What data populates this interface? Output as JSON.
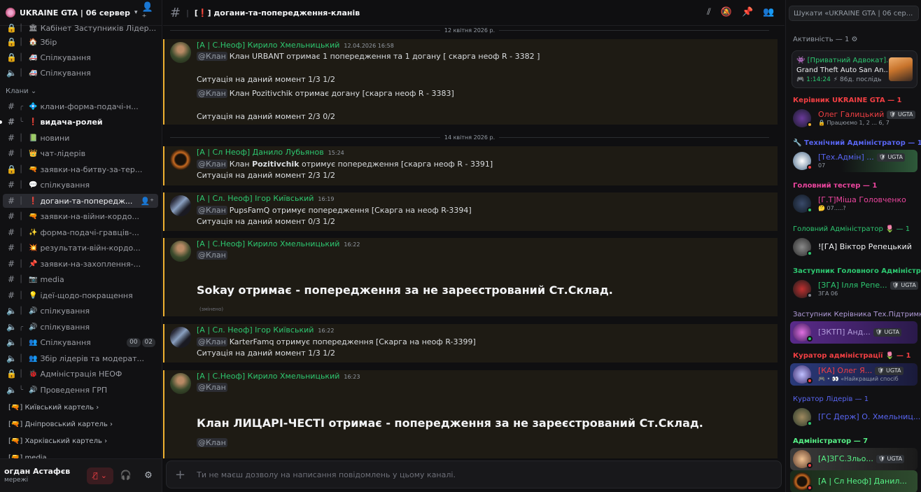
{
  "server": {
    "name": "UKRAINE GTA | 06 сервер"
  },
  "sidebar": {
    "channels": [
      {
        "icon": "lock",
        "emoji": "🏛",
        "name": "Кабінет Заступників Лідер..."
      },
      {
        "icon": "lock",
        "emoji": "🏠",
        "name": "Збір"
      },
      {
        "icon": "lock",
        "emoji": "🚑",
        "name": "Спілкування"
      },
      {
        "icon": "speaker",
        "emoji": "🚑",
        "name": "Спілкування"
      },
      {
        "icon": "hash",
        "emoji": "💠",
        "name": "клани-форма-подачі-н..."
      },
      {
        "icon": "hash",
        "emoji": "❗",
        "name": "видача-ролей"
      },
      {
        "icon": "hash",
        "emoji": "📗",
        "name": "новини"
      },
      {
        "icon": "hash",
        "emoji": "👑",
        "name": "чат-лідерів"
      },
      {
        "icon": "lock",
        "emoji": "🔫",
        "name": "заявки-на-битву-за-тер..."
      },
      {
        "icon": "hash",
        "emoji": "💬",
        "name": "спілкування"
      },
      {
        "icon": "hash",
        "emoji": "❗",
        "name": "догани-та-попередж..."
      },
      {
        "icon": "hash",
        "emoji": "🔫",
        "name": "заявки-на-війни-кордо..."
      },
      {
        "icon": "hash",
        "emoji": "✨",
        "name": "форма-подачі-гравців-..."
      },
      {
        "icon": "hash",
        "emoji": "💥",
        "name": "результати-війн-кордо..."
      },
      {
        "icon": "hash",
        "emoji": "📌",
        "name": "заявки-на-захоплення-..."
      },
      {
        "icon": "hash",
        "emoji": "📷",
        "name": "media"
      },
      {
        "icon": "hash",
        "emoji": "💡",
        "name": "ідеї-щодо-покращення"
      },
      {
        "icon": "speaker",
        "emoji": "🔊",
        "name": "спілкування"
      },
      {
        "icon": "speaker",
        "emoji": "🔊",
        "name": "спілкування"
      },
      {
        "icon": "speaker",
        "emoji": "👥",
        "name": "Спілкування"
      },
      {
        "icon": "speaker",
        "emoji": "👥",
        "name": "Збір лідерів та модерат..."
      },
      {
        "icon": "lock",
        "emoji": "🐞",
        "name": "Адміністрація НЕОФ"
      },
      {
        "icon": "speaker",
        "emoji": "🔊",
        "name": "Проведення ГРП"
      }
    ],
    "category": "Клани",
    "voice_badges": [
      "00",
      "02"
    ],
    "folders": [
      "Київський картель",
      "Дніпровський картель",
      "Харківський картель",
      "media"
    ]
  },
  "user": {
    "name": "огдан Астафєв",
    "status": "мережі"
  },
  "channel": {
    "title": "догани-та-попередження-кланів"
  },
  "messages": {
    "date1": "12 квітня 2026 р.",
    "date2": "14 квітня 2026 р.",
    "m1": {
      "author": "[А | С.Неоф] Кирило Хмельницький",
      "time": "12.04.2026 16:58",
      "mention": "@Клан",
      "l1": "Клан URBANT отримає 1 попередження та 1 догану [ скарга неоф R - 3382 ]",
      "l2": "Ситуація на даний момент 1/3 1/2",
      "l3": "Клан Pozitivchik отримає догану [скарга неоф R - 3383]",
      "l4": "Ситуація на даний момент 2/3 0/2"
    },
    "m2": {
      "author": "[А | Сл Неоф] Данило Лубьянов",
      "time": "15:24",
      "mention": "@Клан",
      "l1a": "Клан ",
      "l1b": "Pozitivchik",
      "l1c": " отримує попередження [скарга неоф R - 3391]",
      "l2": "Ситуація на даний момент 2/3 1/2"
    },
    "m3": {
      "author": "[А | Сл. Неоф] Ігор Київський",
      "time": "16:19",
      "mention": "@Клан",
      "l1": "PupsFamQ отримує попередження [Скарга на неоф R-3394]",
      "l2": "Ситуація на даний момент 0/3 1/2"
    },
    "m4": {
      "author": "[А | С.Неоф] Кирило Хмельницький",
      "time": "16:22",
      "mention": "@Клан",
      "big": "Sokay отримає - попередження за не зареєстрований Ст.Склад.",
      "edited": "(змінено)"
    },
    "m5": {
      "author": "[А | Сл. Неоф] Ігор Київський",
      "time": "16:22",
      "mention": "@Клан",
      "l1": "KarterFamq отримує попередження [Скарга на неоф R-3399]",
      "l2": "Ситуація на даний момент 1/3 1/2"
    },
    "m6": {
      "author": "[А | С.Неоф] Кирило Хмельницький",
      "time": "16:23",
      "mention": "@Клан",
      "big": "Клан ЛИЦАРІ-ЧЕСТІ отримає - попередження за не зареєстрований Ст.Склад.",
      "mention2": "@Клан"
    }
  },
  "composer": {
    "placeholder": "Ти не маєш дозволу на написання повідомлень у цьому каналі."
  },
  "right": {
    "search_placeholder": "Шукати «UKRAINE GTA | 06 сер...",
    "activity_label": "Активність — 1",
    "activity": {
      "title": "[Приватний Адвокат]...",
      "game": "Grand Theft Auto San An...",
      "time": "1:14:24",
      "ago": "86д. послідь"
    },
    "roles": [
      {
        "label": "Керівник UKRAINE GTA — 1",
        "color": "#f23f43"
      },
      {
        "label": "Технічний Адміністратор — 1",
        "color": "#5865f2"
      },
      {
        "label": "Головний тестер — 1",
        "color": "#eb459e"
      },
      {
        "label": "Головний Адміністратор 🌷 — 1",
        "color": "#2dc770"
      },
      {
        "label": "Заступник Головного Адміністратора",
        "color": "#2dc770"
      },
      {
        "label": "Заступник Керівника Тех.Підтримки",
        "color": "#b39ddb"
      },
      {
        "label": "Куратор адміністрації 🌷 — 1",
        "color": "#f23f43"
      },
      {
        "label": "Куратор Лідерів — 1",
        "color": "#5865f2"
      },
      {
        "label": "Адміністратор — 7",
        "color": "#57f287"
      }
    ],
    "members": [
      {
        "name": "Олег Галицький",
        "tag": "UGTA",
        "sub": "Працюємо 1, 2 ... 6, 7",
        "color": "#f23f43"
      },
      {
        "name": "[Тех.Адмін] ...",
        "tag": "UGTA",
        "sub": "07",
        "color": "#5865f2"
      },
      {
        "name": "[Г.Т]Міша Головченко",
        "tag": "",
        "sub": "07.....?",
        "color": "#eb459e"
      },
      {
        "name": "![ГА] Віктор Репецький",
        "tag": "",
        "sub": "",
        "color": "#2dc770"
      },
      {
        "name": "[ЗГА] Ілля Репе...",
        "tag": "UGTA",
        "sub": "ЗГА 06",
        "color": "#2dc770"
      },
      {
        "name": "[ЗКТП] Анд...",
        "tag": "UGTA",
        "sub": "",
        "color": "#b39ddb"
      },
      {
        "name": "[КА] Олег Я...",
        "tag": "UGTA",
        "sub": "«Найкращий спосіб",
        "color": "#f23f43"
      },
      {
        "name": "[ГС Держ] О. Хмельниц...",
        "tag": "",
        "sub": "",
        "color": "#5865f2"
      },
      {
        "name": "[А]ЗГС.Зльо...",
        "tag": "UGTA",
        "sub": "",
        "color": "#57f287"
      },
      {
        "name": "[А | Сл Неоф] Данил...",
        "tag": "",
        "sub": "",
        "color": "#57f287"
      }
    ]
  }
}
